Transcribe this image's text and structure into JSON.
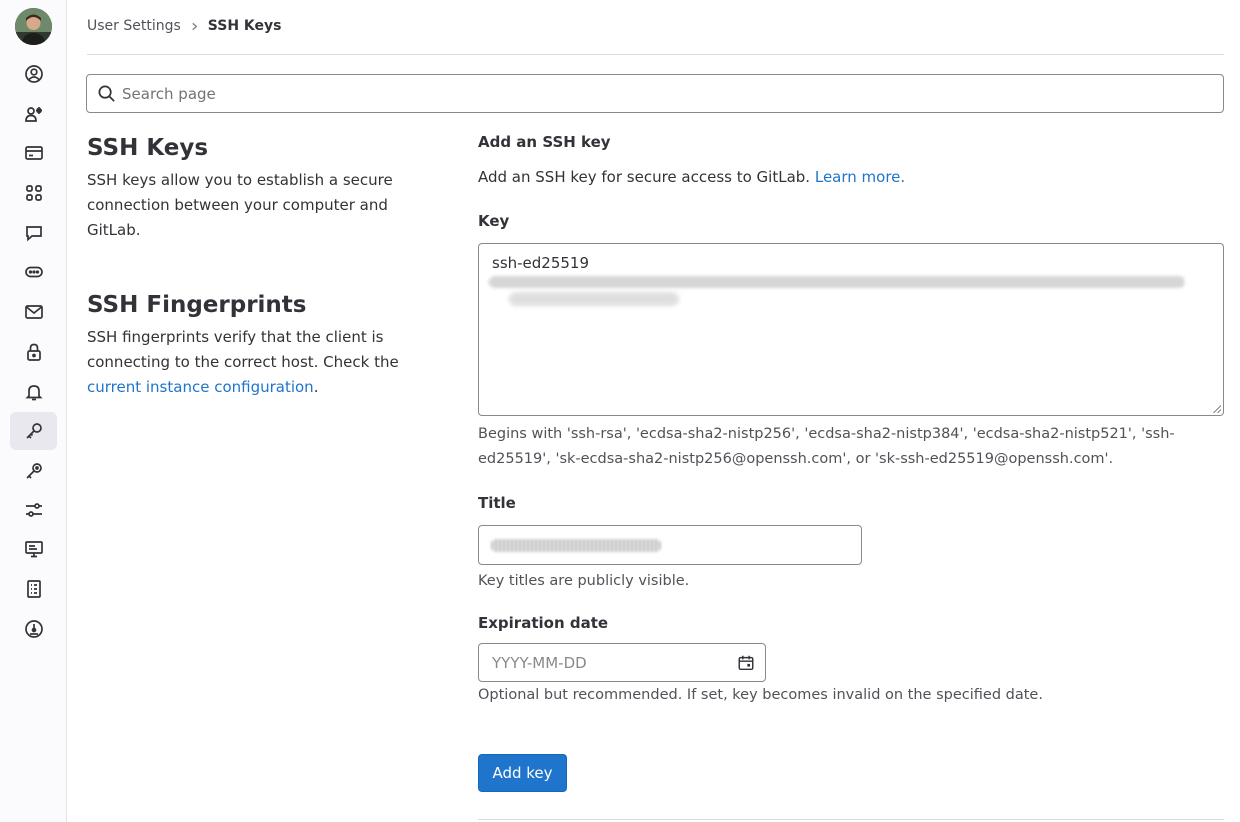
{
  "breadcrumb": {
    "parent": "User Settings",
    "current": "SSH Keys"
  },
  "search": {
    "placeholder": "Search page"
  },
  "sidebar": {
    "items": [
      {
        "icon": "profile-icon"
      },
      {
        "icon": "account-icon"
      },
      {
        "icon": "billing-icon"
      },
      {
        "icon": "applications-icon"
      },
      {
        "icon": "chat-icon"
      },
      {
        "icon": "access-tokens-icon"
      },
      {
        "icon": "emails-icon"
      },
      {
        "icon": "password-icon"
      },
      {
        "icon": "notifications-icon"
      },
      {
        "icon": "ssh-keys-icon",
        "active": true
      },
      {
        "icon": "gpg-keys-icon"
      },
      {
        "icon": "preferences-icon"
      },
      {
        "icon": "active-sessions-icon"
      },
      {
        "icon": "authentication-log-icon"
      },
      {
        "icon": "usage-quotas-icon"
      }
    ]
  },
  "left": {
    "ssh_title": "SSH Keys",
    "ssh_desc": "SSH keys allow you to establish a secure connection between your computer and GitLab.",
    "fp_title": "SSH Fingerprints",
    "fp_desc_before": "SSH fingerprints verify that the client is connecting to the correct host. Check the ",
    "fp_link": "current instance configuration",
    "fp_desc_after": "."
  },
  "form": {
    "title": "Add an SSH key",
    "desc": "Add an SSH key for secure access to GitLab.",
    "learn_more": "Learn more.",
    "key_label": "Key",
    "key_value_prefix": "ssh-ed25519",
    "key_help": "Begins with 'ssh-rsa', 'ecdsa-sha2-nistp256', 'ecdsa-sha2-nistp384', 'ecdsa-sha2-nistp521', 'ssh-ed25519', 'sk-ecdsa-sha2-nistp256@openssh.com', or 'sk-ssh-ed25519@openssh.com'.",
    "title_label": "Title",
    "title_help": "Key titles are publicly visible.",
    "expiration_label": "Expiration date",
    "expiration_placeholder": "YYYY-MM-DD",
    "expiration_help": "Optional but recommended. If set, key becomes invalid on the specified date.",
    "submit_label": "Add key"
  },
  "colors": {
    "accent": "#1f75cb",
    "text": "#333238",
    "muted": "#535158",
    "border": "#89888d"
  }
}
